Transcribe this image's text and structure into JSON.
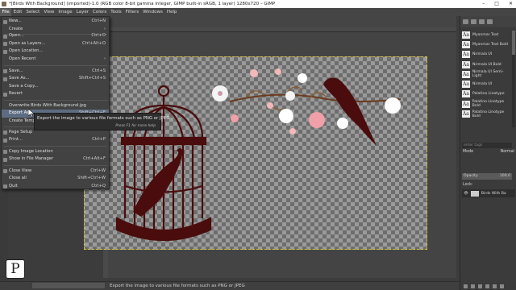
{
  "window": {
    "title": "*[Birds With Background] (imported)-1.0 (RGB color 8-bit gamma integer, GIMP built-in sRGB, 1 layer) 1280x720 – GIMP",
    "controls": [
      "–",
      "□",
      "✕"
    ]
  },
  "menubar": [
    "File",
    "Edit",
    "Select",
    "View",
    "Image",
    "Layer",
    "Colors",
    "Tools",
    "Filters",
    "Windows",
    "Help"
  ],
  "file_menu": [
    {
      "label": "New...",
      "shortcut": "Ctrl+N"
    },
    {
      "label": "Create",
      "shortcut": "›"
    },
    {
      "label": "Open...",
      "shortcut": "Ctrl+O"
    },
    {
      "label": "Open as Layers...",
      "shortcut": "Ctrl+Alt+O"
    },
    {
      "label": "Open Location...",
      "shortcut": ""
    },
    {
      "label": "Open Recent",
      "shortcut": "›"
    },
    {
      "label": "Save...",
      "shortcut": "Ctrl+S"
    },
    {
      "label": "Save As...",
      "shortcut": "Shift+Ctrl+S"
    },
    {
      "label": "Save a Copy...",
      "shortcut": ""
    },
    {
      "label": "Revert",
      "shortcut": ""
    },
    {
      "label": "Overwrite Birds With Background.jpg",
      "shortcut": ""
    },
    {
      "label": "Export As...",
      "shortcut": "Shift+Ctrl+E"
    },
    {
      "label": "Create Template...",
      "shortcut": ""
    },
    {
      "label": "Page Setup",
      "shortcut": ""
    },
    {
      "label": "Print...",
      "shortcut": "Ctrl+P"
    },
    {
      "label": "Copy Image Location",
      "shortcut": ""
    },
    {
      "label": "Show in File Manager",
      "shortcut": "Ctrl+Alt+F"
    },
    {
      "label": "Close View",
      "shortcut": "Ctrl+W"
    },
    {
      "label": "Close all",
      "shortcut": "Shift+Ctrl+W"
    },
    {
      "label": "Quit",
      "shortcut": "Ctrl+Q"
    }
  ],
  "tooltip": {
    "text": "Export the image to various file formats such as PNG or JPEG",
    "hint": "Press F1 for more help"
  },
  "statusbar": {
    "text": "Export the image to various file formats such as PNG or JPEG"
  },
  "fonts": [
    "Myanmar Text",
    "Myanmar Text Bold",
    "Nirmala UI",
    "Nirmala UI Bold",
    "Nirmala UI Semi-Light",
    "Nirmala UI",
    "Palatino Linotype",
    "Palatino Linotype Bold",
    "Palatino Linotype Bold"
  ],
  "font_tag_placeholder": "enter tags",
  "layers_panel": {
    "mode_label": "Mode",
    "mode_value": "Normal",
    "opacity_label": "Opacity",
    "opacity_value": "100.0",
    "lock_label": "Lock:",
    "layer_name": "Birds With Ba"
  },
  "logo": "P"
}
